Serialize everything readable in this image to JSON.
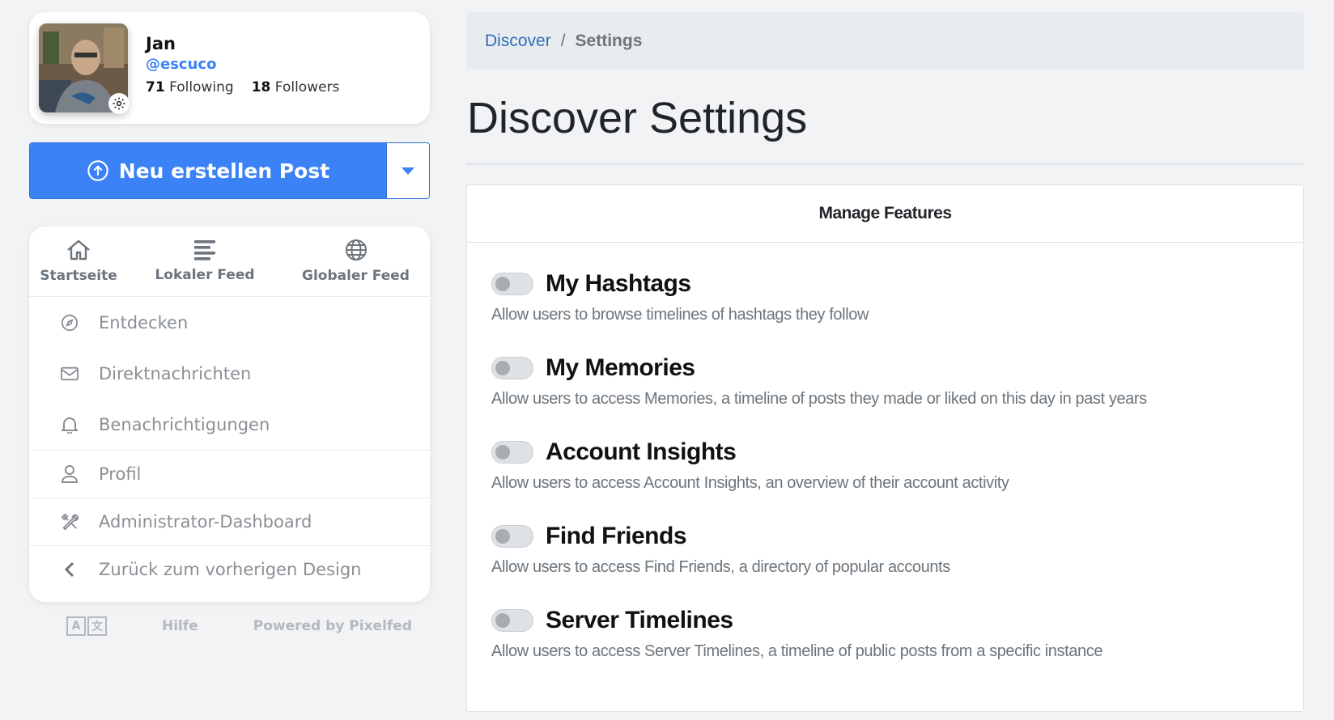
{
  "profile": {
    "name": "Jan",
    "handle": "@escuco",
    "following_count": "71",
    "following_label": "Following",
    "followers_count": "18",
    "followers_label": "Followers"
  },
  "compose": {
    "label": "Neu erstellen Post",
    "icon": "upload-circle-icon"
  },
  "nav": {
    "tabs": [
      {
        "label": "Startseite",
        "icon": "home-icon"
      },
      {
        "label": "Lokaler Feed",
        "icon": "list-icon"
      },
      {
        "label": "Globaler Feed",
        "icon": "globe-icon"
      }
    ],
    "items": [
      {
        "label": "Entdecken",
        "icon": "compass-icon"
      },
      {
        "label": "Direktnachrichten",
        "icon": "envelope-icon"
      },
      {
        "label": "Benachrichtigungen",
        "icon": "bell-icon"
      },
      {
        "label": "Profil",
        "icon": "user-icon"
      },
      {
        "label": "Administrator-Dashboard",
        "icon": "tools-icon"
      },
      {
        "label": "Zurück zum vorherigen Design",
        "icon": "chevron-left-icon"
      }
    ]
  },
  "footer": {
    "language_icon": "language-icon",
    "help": "Hilfe",
    "powered": "Powered by Pixelfed"
  },
  "breadcrumb": {
    "parent": "Discover",
    "separator": "/",
    "current": "Settings"
  },
  "page": {
    "title": "Discover Settings"
  },
  "features": {
    "header": "Manage Features",
    "items": [
      {
        "title": "My Hashtags",
        "description": "Allow users to browse timelines of hashtags they follow",
        "enabled": false
      },
      {
        "title": "My Memories",
        "description": "Allow users to access Memories, a timeline of posts they made or liked on this day in past years",
        "enabled": false
      },
      {
        "title": "Account Insights",
        "description": "Allow users to access Account Insights, an overview of their account activity",
        "enabled": false
      },
      {
        "title": "Find Friends",
        "description": "Allow users to access Find Friends, a directory of popular accounts",
        "enabled": false
      },
      {
        "title": "Server Timelines",
        "description": "Allow users to access Server Timelines, a timeline of public posts from a specific instance",
        "enabled": false
      }
    ]
  },
  "colors": {
    "accent": "#3b82f6",
    "link": "#2a6fb8",
    "background": "#f2f3f5"
  }
}
